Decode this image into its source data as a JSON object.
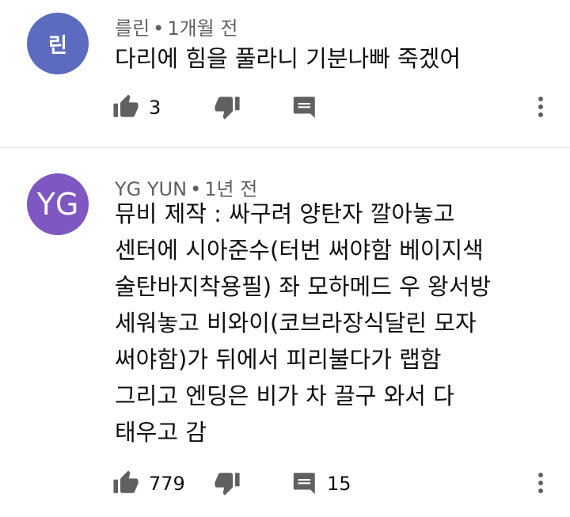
{
  "colors": {
    "avatar1": "#5c6bc0",
    "avatar2": "#7e57c2",
    "meta": "#606060",
    "icon": "#606060"
  },
  "comments": [
    {
      "avatar_text": "린",
      "author": "를린",
      "separator": "•",
      "time": "1개월 전",
      "lines": [
        "다리에 힘을 풀라니 기분나빠 죽겠어"
      ],
      "likes": "3",
      "replies": ""
    },
    {
      "avatar_text": "YG",
      "author": "YG YUN",
      "separator": "•",
      "time": "1년 전",
      "lines": [
        "뮤비 제작 : 싸구려 양탄자 깔아놓고",
        "센터에 시아준수(터번 써야함 베이지색",
        "술탄바지착용필) 좌 모하메드 우 왕서방",
        "세워놓고 비와이(코브라장식달린 모자",
        "써야함)가 뒤에서 피리불다가 랩함",
        "그리고 엔딩은 비가 차 끌구 와서 다",
        "태우고 감"
      ],
      "likes": "779",
      "replies": "15"
    }
  ]
}
